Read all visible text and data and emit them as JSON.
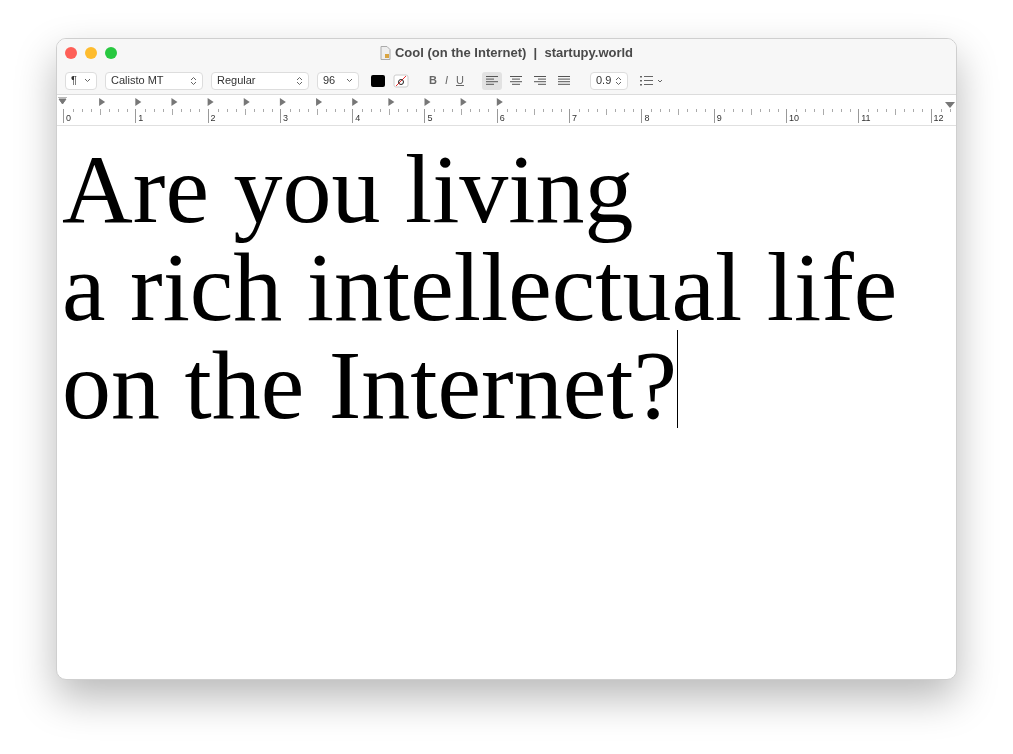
{
  "window": {
    "title": "Cool (on the Internet)  |  startupy.world"
  },
  "toolbar": {
    "paragraph_style": "¶",
    "font_family": "Calisto MT",
    "typeface": "Regular",
    "font_size": "96",
    "styles": [
      {
        "label": "B",
        "kind": "bold"
      },
      {
        "label": "I",
        "kind": "italic"
      },
      {
        "label": "U",
        "kind": "underline"
      }
    ],
    "alignments": [
      {
        "kind": "left",
        "selected": true
      },
      {
        "kind": "center",
        "selected": false
      },
      {
        "kind": "right",
        "selected": false
      },
      {
        "kind": "justify",
        "selected": false
      }
    ],
    "line_spacing": "0.9"
  },
  "ruler": {
    "numbers": [
      "0",
      "1",
      "2",
      "3",
      "4",
      "5",
      "6",
      "7",
      "8",
      "9",
      "10",
      "11",
      "12"
    ]
  },
  "document": {
    "lines": [
      "Are you living",
      "a rich intellectual life",
      "on the Internet?"
    ]
  }
}
